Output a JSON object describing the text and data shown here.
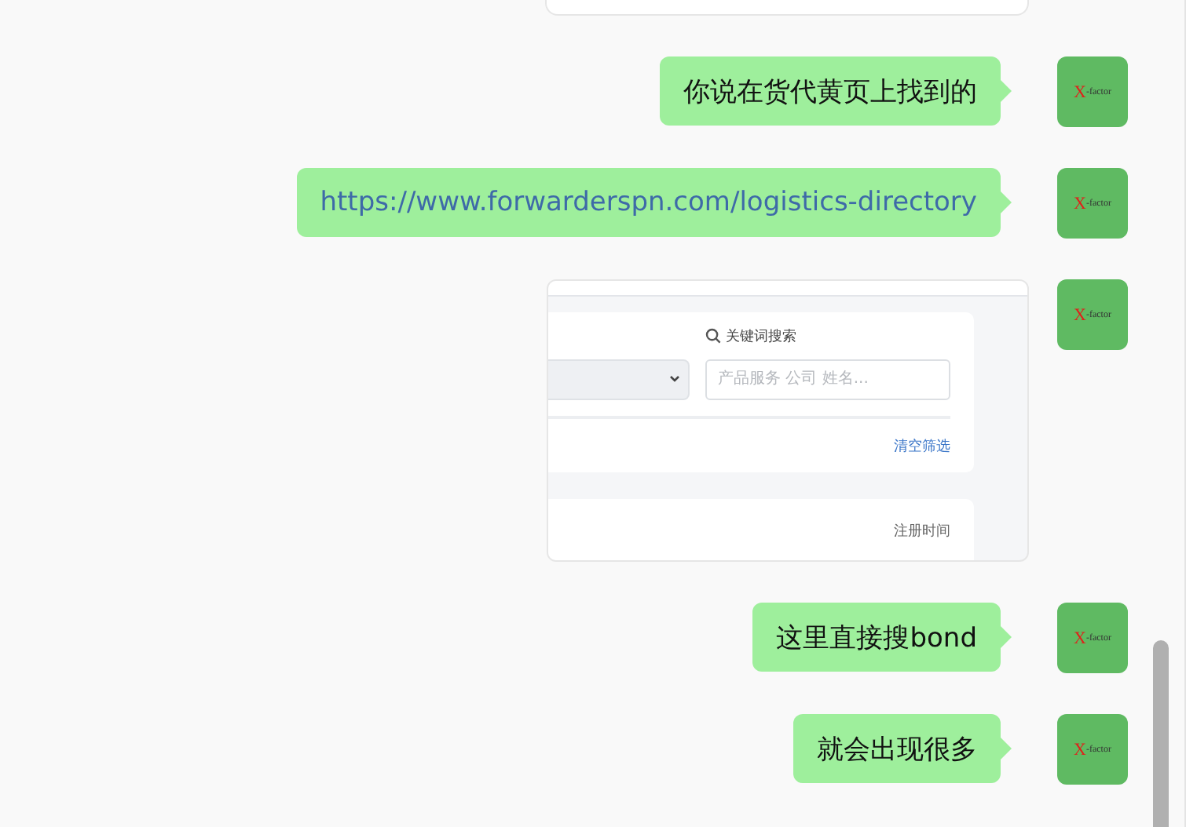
{
  "messages": [
    {
      "kind": "text",
      "text": "你说在货代黄页上找到的",
      "avatar": {
        "mark": "X",
        "text": "-factor"
      }
    },
    {
      "kind": "link",
      "text": "https://www.forwarderspn.com/logistics-directory",
      "avatar": {
        "mark": "X",
        "text": "-factor"
      }
    },
    {
      "kind": "image",
      "image": {
        "search_label": "关键词搜索",
        "search_placeholder": "产品服务 公司 姓名...",
        "clear_link": "清空筛选",
        "column_label": "注册时间"
      },
      "avatar": {
        "mark": "X",
        "text": "-factor"
      }
    },
    {
      "kind": "text",
      "text": "这里直接搜bond",
      "avatar": {
        "mark": "X",
        "text": "-factor"
      }
    },
    {
      "kind": "text",
      "text": "就会出现很多",
      "avatar": {
        "mark": "X",
        "text": "-factor"
      }
    }
  ]
}
